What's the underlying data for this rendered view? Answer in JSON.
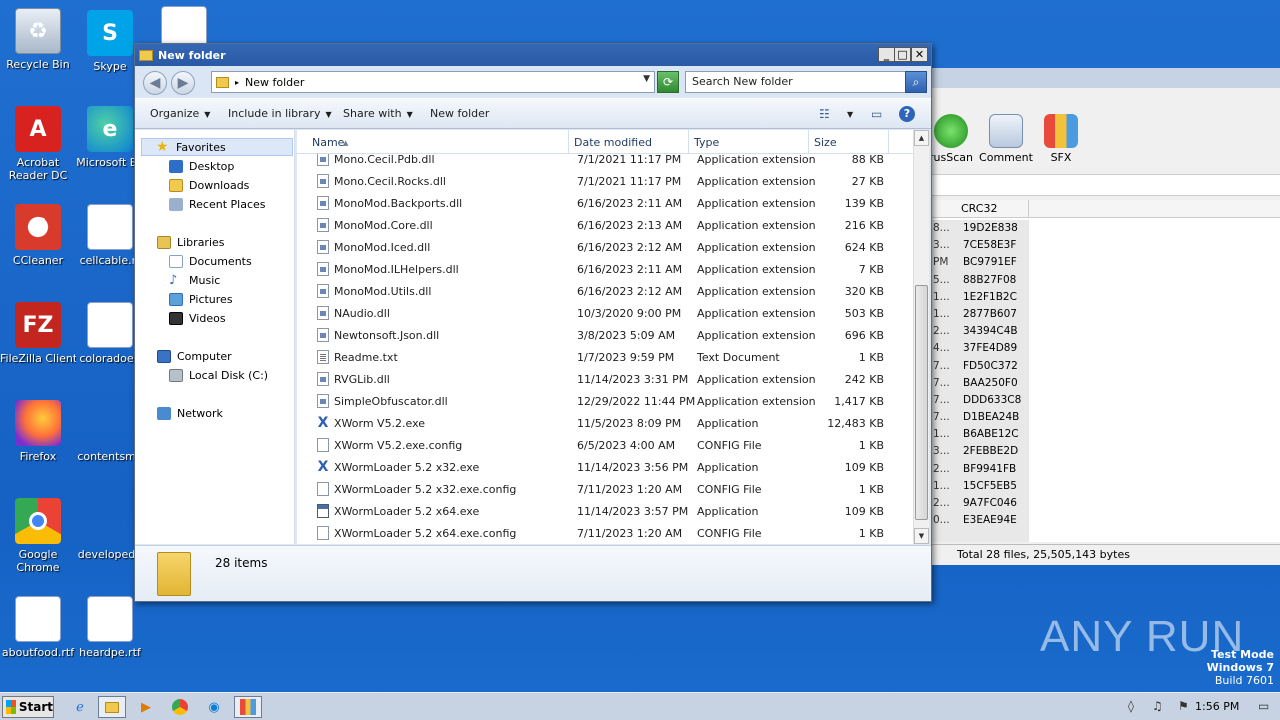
{
  "desktop": {
    "icons": [
      {
        "label": "Recycle Bin",
        "icon": "recycle-bin-icon"
      },
      {
        "label": "Skype",
        "icon": "skype-icon"
      },
      {
        "label": "Acrobat Reader DC",
        "icon": "acrobat-icon"
      },
      {
        "label": "Microsoft Ed",
        "icon": "edge-icon"
      },
      {
        "label": "CCleaner",
        "icon": "ccleaner-icon"
      },
      {
        "label": "cellcable.rt",
        "icon": "word-doc-icon"
      },
      {
        "label": "FileZilla Client",
        "icon": "filezilla-icon"
      },
      {
        "label": "coloradoen",
        "icon": "word-doc-icon"
      },
      {
        "label": "Firefox",
        "icon": "firefox-icon"
      },
      {
        "label": "contentsme",
        "icon": "word-doc-icon"
      },
      {
        "label": "Google Chrome",
        "icon": "chrome-icon"
      },
      {
        "label": "developedb",
        "icon": "word-doc-icon"
      },
      {
        "label": "aboutfood.rtf",
        "icon": "word-doc-icon"
      },
      {
        "label": "heardpe.rtf",
        "icon": "word-doc-icon"
      }
    ]
  },
  "bg_app": {
    "toolbar": [
      {
        "label": "rusScan"
      },
      {
        "label": "Comment"
      },
      {
        "label": "SFX"
      }
    ],
    "column_header": "CRC32",
    "rows": [
      {
        "a": "8...",
        "crc": "19D2E838"
      },
      {
        "a": "3...",
        "crc": "7CE58E3F"
      },
      {
        "a": "PM",
        "crc": "BC9791EF"
      },
      {
        "a": "5...",
        "crc": "88B27F08"
      },
      {
        "a": "1...",
        "crc": "1E2F1B2C"
      },
      {
        "a": "1...",
        "crc": "2877B607"
      },
      {
        "a": "2...",
        "crc": "34394C4B"
      },
      {
        "a": "4...",
        "crc": "37FE4D89"
      },
      {
        "a": "7...",
        "crc": "FD50C372"
      },
      {
        "a": "7...",
        "crc": "BAA250F0"
      },
      {
        "a": "7...",
        "crc": "DDD633C8"
      },
      {
        "a": "7...",
        "crc": "D1BEA24B"
      },
      {
        "a": "1...",
        "crc": "B6ABE12C"
      },
      {
        "a": "3...",
        "crc": "2FEBBE2D"
      },
      {
        "a": "2...",
        "crc": "BF9941FB"
      },
      {
        "a": "1...",
        "crc": "15CF5EB5"
      },
      {
        "a": "2...",
        "crc": "9A7FC046"
      },
      {
        "a": "0...",
        "crc": "E3EAE94E"
      }
    ],
    "status": "Total 28 files, 25,505,143 bytes"
  },
  "explorer": {
    "title": "New folder",
    "address": "New folder",
    "search_placeholder": "Search New folder",
    "commands": {
      "organize": "Organize",
      "include": "Include in library",
      "share": "Share with",
      "new_folder": "New folder"
    },
    "nav": {
      "favorites": "Favorites",
      "desktop": "Desktop",
      "downloads": "Downloads",
      "recent": "Recent Places",
      "libraries": "Libraries",
      "documents": "Documents",
      "music": "Music",
      "pictures": "Pictures",
      "videos": "Videos",
      "computer": "Computer",
      "local_disk": "Local Disk (C:)",
      "network": "Network"
    },
    "columns": {
      "name": "Name",
      "date": "Date modified",
      "type": "Type",
      "size": "Size"
    },
    "files": [
      {
        "name": "Mono.Cecil.Pdb.dll",
        "date": "7/1/2021 11:17 PM",
        "type": "Application extension",
        "size": "88 KB",
        "icon": "dll"
      },
      {
        "name": "Mono.Cecil.Rocks.dll",
        "date": "7/1/2021 11:17 PM",
        "type": "Application extension",
        "size": "27 KB",
        "icon": "dll"
      },
      {
        "name": "MonoMod.Backports.dll",
        "date": "6/16/2023 2:11 AM",
        "type": "Application extension",
        "size": "139 KB",
        "icon": "dll"
      },
      {
        "name": "MonoMod.Core.dll",
        "date": "6/16/2023 2:13 AM",
        "type": "Application extension",
        "size": "216 KB",
        "icon": "dll"
      },
      {
        "name": "MonoMod.Iced.dll",
        "date": "6/16/2023 2:12 AM",
        "type": "Application extension",
        "size": "624 KB",
        "icon": "dll"
      },
      {
        "name": "MonoMod.ILHelpers.dll",
        "date": "6/16/2023 2:11 AM",
        "type": "Application extension",
        "size": "7 KB",
        "icon": "dll"
      },
      {
        "name": "MonoMod.Utils.dll",
        "date": "6/16/2023 2:12 AM",
        "type": "Application extension",
        "size": "320 KB",
        "icon": "dll"
      },
      {
        "name": "NAudio.dll",
        "date": "10/3/2020 9:00 PM",
        "type": "Application extension",
        "size": "503 KB",
        "icon": "dll"
      },
      {
        "name": "Newtonsoft.Json.dll",
        "date": "3/8/2023 5:09 AM",
        "type": "Application extension",
        "size": "696 KB",
        "icon": "dll"
      },
      {
        "name": "Readme.txt",
        "date": "1/7/2023 9:59 PM",
        "type": "Text Document",
        "size": "1 KB",
        "icon": "txt"
      },
      {
        "name": "RVGLib.dll",
        "date": "11/14/2023 3:31 PM",
        "type": "Application extension",
        "size": "242 KB",
        "icon": "dll"
      },
      {
        "name": "SimpleObfuscator.dll",
        "date": "12/29/2022 11:44 PM",
        "type": "Application extension",
        "size": "1,417 KB",
        "icon": "dll"
      },
      {
        "name": "XWorm V5.2.exe",
        "date": "11/5/2023 8:09 PM",
        "type": "Application",
        "size": "12,483 KB",
        "icon": "xworm"
      },
      {
        "name": "XWorm V5.2.exe.config",
        "date": "6/5/2023 4:00 AM",
        "type": "CONFIG File",
        "size": "1 KB",
        "icon": "cfg"
      },
      {
        "name": "XWormLoader 5.2 x32.exe",
        "date": "11/14/2023 3:56 PM",
        "type": "Application",
        "size": "109 KB",
        "icon": "xworm"
      },
      {
        "name": "XWormLoader 5.2 x32.exe.config",
        "date": "7/11/2023 1:20 AM",
        "type": "CONFIG File",
        "size": "1 KB",
        "icon": "cfg"
      },
      {
        "name": "XWormLoader 5.2 x64.exe",
        "date": "11/14/2023 3:57 PM",
        "type": "Application",
        "size": "109 KB",
        "icon": "app"
      },
      {
        "name": "XWormLoader 5.2 x64.exe.config",
        "date": "7/11/2023 1:20 AM",
        "type": "CONFIG File",
        "size": "1 KB",
        "icon": "cfg"
      }
    ],
    "item_count": "28 items"
  },
  "watermark": "ANY RUN",
  "test_mode": {
    "line1": "Test Mode",
    "line2": "Windows 7",
    "line3": "Build 7601"
  },
  "taskbar": {
    "start_label": "Start",
    "clock": "1:56 PM"
  }
}
